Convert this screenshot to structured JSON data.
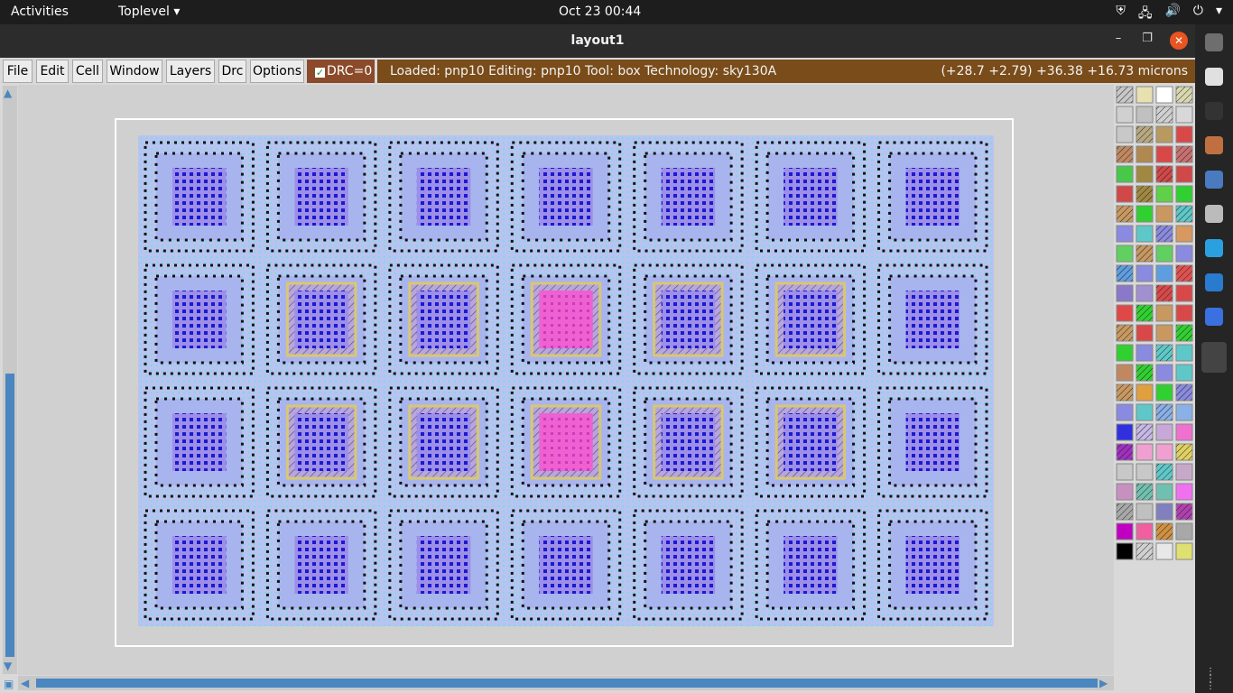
{
  "topbar": {
    "activities": "Activities",
    "app_menu": "Toplevel",
    "app_menu_arrow": "▾",
    "clock": "Oct 23  00:44",
    "tray_icons": [
      "shield-icon",
      "network-icon",
      "volume-icon",
      "power-icon"
    ],
    "tray_glyphs": [
      "⛨",
      "🖧",
      "🔊",
      "⏻"
    ],
    "tray_more": "▾"
  },
  "window": {
    "title": "layout1",
    "minimize": "–",
    "maximize": "❐",
    "close": "✕"
  },
  "menu": {
    "items": [
      "File",
      "Edit",
      "Cell",
      "Window",
      "Layers",
      "Drc",
      "Options"
    ],
    "drc_label": "DRC=0",
    "drc_check": "✓"
  },
  "status": {
    "left": "Loaded: pnp10 Editing: pnp10 Tool: box  Technology: sky130A",
    "right": "(+28.7 +2.79) +36.38 +16.73 microns"
  },
  "layout": {
    "grid_cols": 7,
    "grid_rows": 4,
    "highlighted_cells": [
      [
        1,
        1
      ],
      [
        1,
        2
      ],
      [
        1,
        4
      ],
      [
        1,
        5
      ],
      [
        2,
        1
      ],
      [
        2,
        2
      ],
      [
        2,
        4
      ],
      [
        2,
        5
      ]
    ],
    "pink_cells": [
      [
        1,
        3
      ],
      [
        2,
        3
      ]
    ]
  },
  "colors": {
    "accent": "#7a4c1a",
    "drc": "#8b4a2a",
    "scroll": "#4a86c0",
    "close": "#e95420",
    "layout_bg": "#b8c4f0"
  },
  "palette": {
    "rows": 24,
    "cols": 4
  },
  "dock": {
    "apps": [
      "files-icon",
      "chrome-icon",
      "terminal-icon",
      "app-icon",
      "editor-icon",
      "settings-icon",
      "telegram-icon",
      "vscode-icon",
      "screenshot-icon",
      "window-icon"
    ]
  },
  "show_apps_glyph": "⋮⋮⋮"
}
